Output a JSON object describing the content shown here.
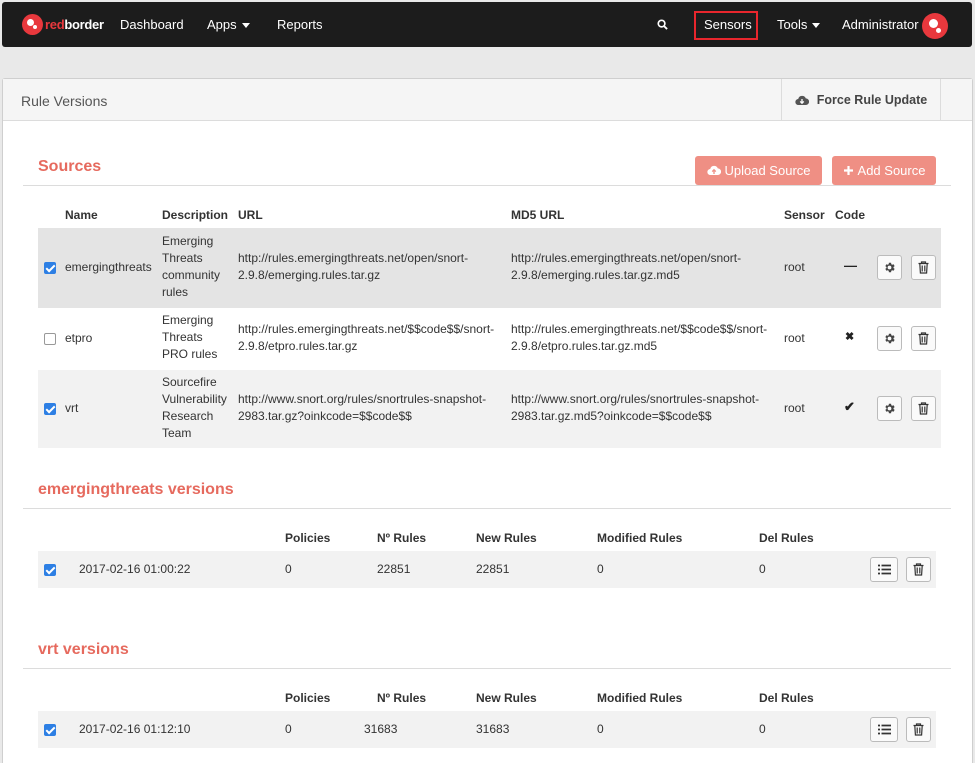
{
  "nav": {
    "brand_red": "red",
    "brand_white": "border",
    "items": [
      "Dashboard",
      "Apps",
      "Reports"
    ],
    "right_items": [
      "Sensors",
      "Tools",
      "Administrator"
    ]
  },
  "panel": {
    "title": "Rule Versions",
    "force_update_label": "Force Rule Update"
  },
  "sources": {
    "title": "Sources",
    "upload_label": "Upload Source",
    "add_label": "Add Source",
    "columns": [
      "Name",
      "Description",
      "URL",
      "MD5 URL",
      "Sensor",
      "Code"
    ],
    "rows": [
      {
        "checked": true,
        "name": "emergingthreats",
        "description": [
          "Emerging",
          "Threats",
          "community",
          "rules"
        ],
        "url": [
          "http://rules.emergingthreats.net/open/snort-",
          "2.9.8/emerging.rules.tar.gz"
        ],
        "md5": [
          "http://rules.emergingthreats.net/open/snort-",
          "2.9.8/emerging.rules.tar.gz.md5"
        ],
        "sensor": "root",
        "code": "—"
      },
      {
        "checked": false,
        "name": "etpro",
        "description": [
          "Emerging",
          "Threats",
          "PRO rules"
        ],
        "url": [
          "http://rules.emergingthreats.net/$$code$$/snort-",
          "2.9.8/etpro.rules.tar.gz"
        ],
        "md5": [
          "http://rules.emergingthreats.net/$$code$$/snort-",
          "2.9.8/etpro.rules.tar.gz.md5"
        ],
        "sensor": "root",
        "code": "✖"
      },
      {
        "checked": true,
        "name": "vrt",
        "description": [
          "Sourcefire",
          "Vulnerability",
          "Research",
          "Team"
        ],
        "url": [
          "http://www.snort.org/rules/snortrules-snapshot-",
          "2983.tar.gz?oinkcode=$$code$$"
        ],
        "md5": [
          "http://www.snort.org/rules/snortrules-snapshot-",
          "2983.tar.gz.md5?oinkcode=$$code$$"
        ],
        "sensor": "root",
        "code": "✔"
      }
    ]
  },
  "version_columns": [
    "Policies",
    "Nº Rules",
    "New Rules",
    "Modified Rules",
    "Del Rules"
  ],
  "et_versions": {
    "title": "emergingthreats versions",
    "row": {
      "checked": true,
      "date": "2017-02-16 01:00:22",
      "policies": "0",
      "rules": "22851",
      "new_rules": "22851",
      "modified": "0",
      "deleted": "0"
    }
  },
  "vrt_versions": {
    "title": "vrt versions",
    "row": {
      "checked": true,
      "date": "2017-02-16 01:12:10",
      "policies": "0",
      "rules": "31683",
      "new_rules": "31683",
      "modified": "0",
      "deleted": "0"
    }
  },
  "colors": {
    "accent": "#e66a5e",
    "button": "#ef8f84",
    "highlight_box": "#e8262d",
    "checkbox": "#2d7fe4",
    "navbar": "#1c1c1c"
  },
  "icons": [
    "search-icon",
    "caret-down-icon",
    "cloud-download-icon",
    "cloud-upload-icon",
    "plus-icon",
    "gear-icon",
    "trash-icon",
    "list-icon",
    "minus-icon",
    "cross-icon",
    "check-icon"
  ]
}
